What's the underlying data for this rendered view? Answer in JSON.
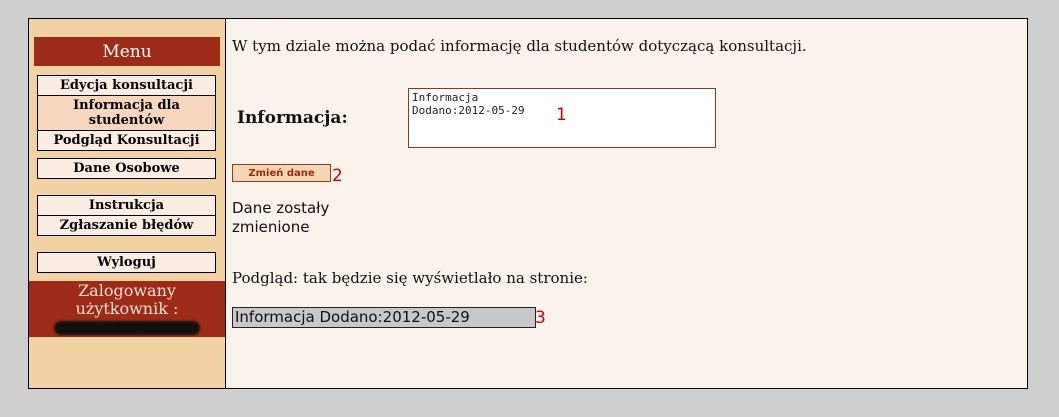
{
  "sidebar": {
    "menu_title": "Menu",
    "group1": [
      "Edycja konsultacji",
      "Informacja dla studentów",
      "Podgląd Konsultacji"
    ],
    "group2": [
      "Dane Osobowe"
    ],
    "group3": [
      "Instrukcja",
      "Zgłaszanie błędów"
    ],
    "group4": [
      "Wyloguj"
    ],
    "logged_label": "Zalogowany użytkownik :"
  },
  "main": {
    "intro": "W tym dziale można podać informację dla studentów dotyczącą konsultacji.",
    "info_label": "Informacja:",
    "info_value": "Informacja\nDodano:2012-05-29",
    "marker1": "1",
    "change_button": "Zmień dane",
    "marker2": "2",
    "status": "Dane zostały zmienione",
    "preview_label": "Podgląd: tak będzie się wyświetlało na stronie:",
    "preview_value": "Informacja Dodano:2012-05-29",
    "marker3": "3"
  }
}
